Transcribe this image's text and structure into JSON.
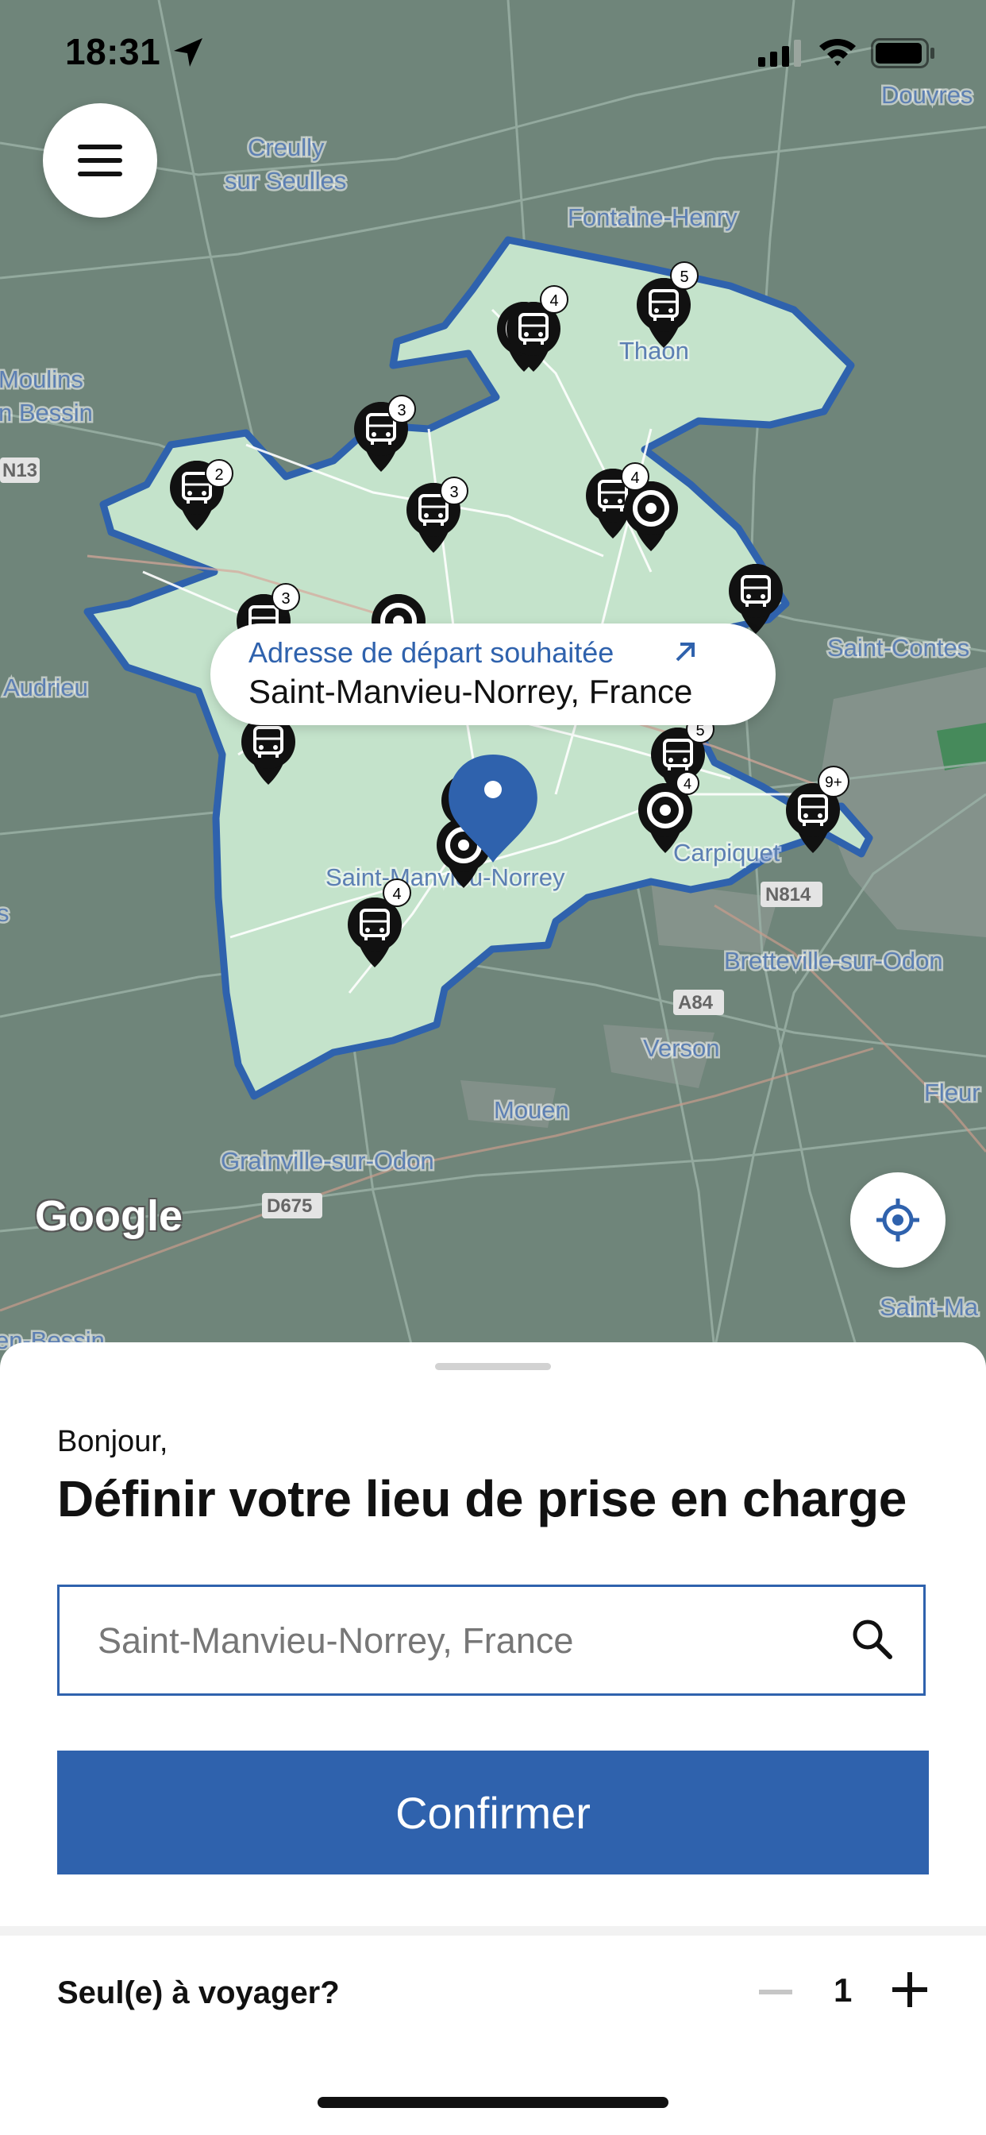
{
  "status_bar": {
    "time": "18:31"
  },
  "map": {
    "places": {
      "douvres": "Douvres",
      "creully": "Creully",
      "sur_seulles": "sur Seulles",
      "fontaine_henry": "Fontaine-Henry",
      "thaon": "Thaon",
      "moulins": "Moulins",
      "en_bessin": "n Bessin",
      "audrieu": "Audrieu",
      "saint_contest": "Saint-Contes",
      "carpiquet": "Carpiquet",
      "saint_manvieu": "Saint-Manvieu-Norrey",
      "bretteville": "Bretteville-sur-Odon",
      "verson": "Verson",
      "mouen": "Mouen",
      "fleury": "Fleur",
      "grainville": "Grainville-sur-Odon",
      "saint_ma": "Saint-Ma",
      "en_bessin_bottom": "en-Bessin",
      "s_left": "s"
    },
    "roads": {
      "n13": "N13",
      "n814": "N814",
      "a84": "A84",
      "d675": "D675"
    },
    "stop_counts": [
      "4",
      "5",
      "3",
      "2",
      "3",
      "4",
      "3",
      "5",
      "4",
      "9+",
      "4"
    ],
    "colors": {
      "zone_fill": "#c4e3cb",
      "zone_border": "#2f62ad",
      "map_bg": "#6f857a",
      "marker": "#2f62ad"
    }
  },
  "tooltip": {
    "title": "Adresse de départ souhaitée",
    "address": "Saint-Manvieu-Norrey, France"
  },
  "google_logo": "Google",
  "sheet": {
    "greeting": "Bonjour,",
    "title": "Définir votre lieu de prise en charge",
    "search": {
      "placeholder": "Saint-Manvieu-Norrey, France"
    },
    "confirm_label": "Confirmer",
    "passengers": {
      "label": "Seul(e) à voyager?",
      "count": "1"
    }
  },
  "icons": [
    "location-arrow-icon",
    "signal-icon",
    "wifi-icon",
    "battery-icon",
    "menu-icon",
    "bus-stop-icon",
    "target-stop-icon",
    "pin-marker-icon",
    "external-arrow-icon",
    "locate-icon",
    "search-icon",
    "minus-icon",
    "plus-icon"
  ],
  "accent_color": "#2f62ad"
}
